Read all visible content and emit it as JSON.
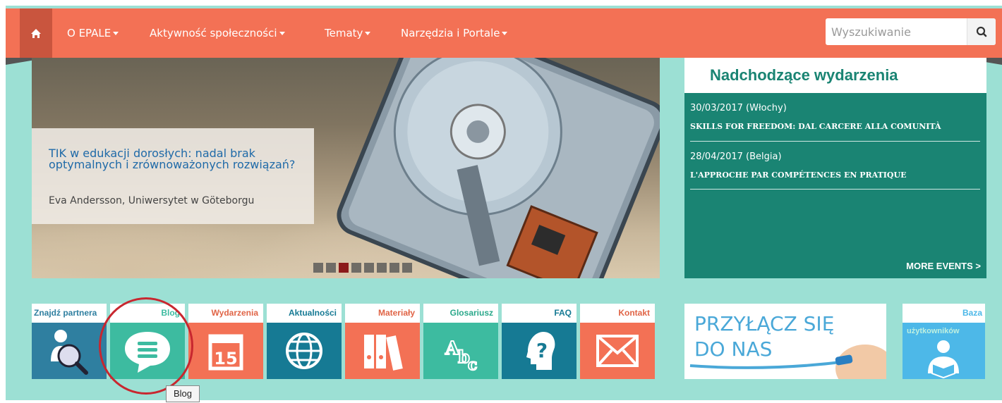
{
  "nav": {
    "items": [
      {
        "label": "O EPALE"
      },
      {
        "label": "Aktywność społeczności"
      },
      {
        "label": "Tematy"
      },
      {
        "label": "Narzędzia i Portale"
      }
    ],
    "search_placeholder": "Wyszukiwanie",
    "home_icon": "home-icon",
    "search_icon": "search-icon"
  },
  "hero": {
    "title": "TIK w edukacji dorosłych: nadal brak optymalnych i zrównoważonych rozwiązań?",
    "author": "Eva Andersson, Uniwersytet w Göteborgu",
    "slide_count": 8,
    "active_slide": 3
  },
  "events": {
    "title": "Nadchodzące wydarzenia",
    "items": [
      {
        "date": "30/03/2017 (Włochy)",
        "name": "SKILLS FOR FREEDOM: DAL CARCERE ALLA COMUNITÀ"
      },
      {
        "date": "28/04/2017 (Belgia)",
        "name": "L'APPROCHE PAR COMPÉTENCES EN PRATIQUE"
      }
    ],
    "more": "MORE EVENTS >"
  },
  "tiles": [
    {
      "label": "Znajdź partnera",
      "color": "#2f7fa0",
      "label_color": "#2f7fa0",
      "icon": "find-partner-icon"
    },
    {
      "label": "Blog",
      "color": "#3dbba0",
      "label_color": "#3dbba0",
      "icon": "chat-bubble-icon"
    },
    {
      "label": "Wydarzenia",
      "color": "#f37155",
      "label_color": "#e06446",
      "icon": "calendar-icon"
    },
    {
      "label": "Aktualności",
      "color": "#167a94",
      "label_color": "#167a94",
      "icon": "globe-icon"
    },
    {
      "label": "Materiały",
      "color": "#f37155",
      "label_color": "#e06446",
      "icon": "binders-icon"
    },
    {
      "label": "Glosariusz",
      "color": "#3dbba0",
      "label_color": "#2aa88a",
      "icon": "abc-icon"
    },
    {
      "label": "FAQ",
      "color": "#167a94",
      "label_color": "#167a94",
      "icon": "question-head-icon"
    },
    {
      "label": "Kontakt",
      "color": "#f37155",
      "label_color": "#e06446",
      "icon": "envelope-icon"
    }
  ],
  "join": {
    "line1": "PRZYŁĄCZ SIĘ",
    "line2": "DO NAS"
  },
  "baza": {
    "label_line1": "Baza",
    "label_line2": "użytkowników",
    "color": "#4db8e8",
    "icon": "reader-icon"
  },
  "tooltip": "Blog",
  "colors": {
    "nav": "#f37155",
    "page_bg": "#9ce0d4",
    "events_bg": "#1a8473"
  }
}
